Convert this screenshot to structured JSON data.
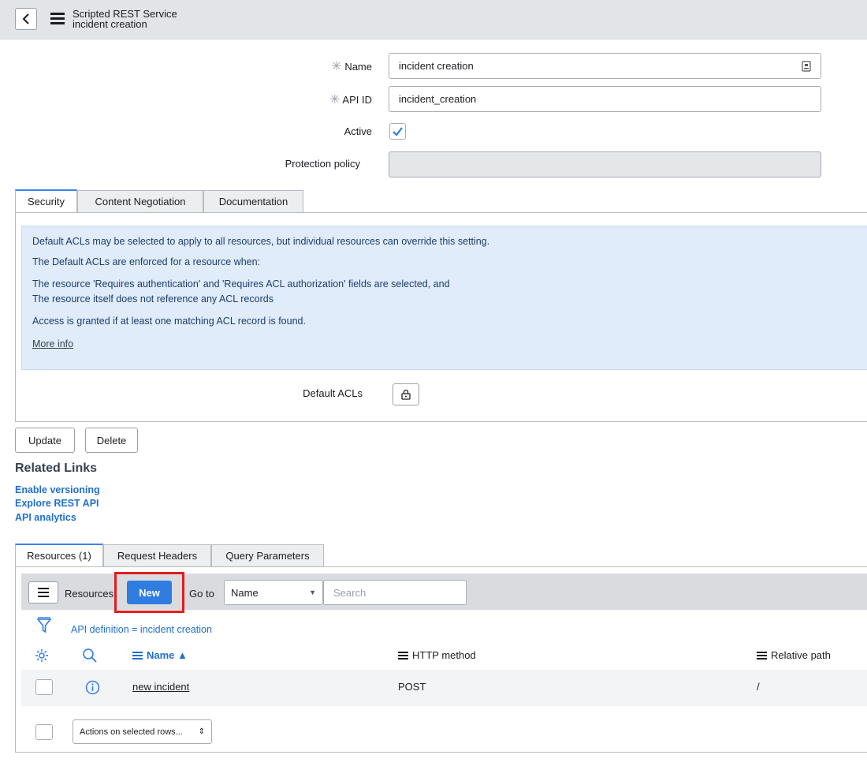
{
  "header": {
    "title_line1": "Scripted REST Service",
    "title_line2": "incident creation"
  },
  "form": {
    "name_label": "Name",
    "name_value": "incident creation",
    "api_id_label": "API ID",
    "api_id_value": "incident_creation",
    "active_label": "Active",
    "active_checked": true,
    "protection_label": "Protection policy",
    "protection_value": ""
  },
  "tabs": {
    "items": [
      "Security",
      "Content Negotiation",
      "Documentation"
    ],
    "active": "Security"
  },
  "security": {
    "info_line1": "Default ACLs may be selected to apply to all resources, but individual resources can override this setting.",
    "info_line2": "The Default ACLs are enforced for a resource when:",
    "info_line3": "The resource 'Requires authentication' and 'Requires ACL authorization' fields are selected, and",
    "info_line4": "The resource itself does not reference any ACL records",
    "info_line5": "Access is granted if at least one matching ACL record is found.",
    "more_info": "More info",
    "default_acls_label": "Default ACLs"
  },
  "actions": {
    "update": "Update",
    "delete": "Delete"
  },
  "related_links": {
    "title": "Related Links",
    "links": [
      "Enable versioning",
      "Explore REST API",
      "API analytics"
    ]
  },
  "related_tabs": {
    "items": [
      "Resources (1)",
      "Request Headers",
      "Query Parameters"
    ],
    "active": "Resources (1)"
  },
  "list": {
    "resources_label": "Resources",
    "new_label": "New",
    "goto_label": "Go to",
    "goto_select": "Name",
    "search_placeholder": "Search",
    "filter_text": "API definition = incident creation",
    "columns": [
      "Name ▲",
      "HTTP method",
      "Relative path"
    ],
    "rows": [
      {
        "name": "new incident",
        "method": "POST",
        "path": "/"
      }
    ],
    "actions_select": "Actions on selected rows..."
  },
  "colors": {
    "accent": "#2f7de1",
    "highlight": "#e11d1d",
    "info_bg": "#e0ecf9"
  }
}
